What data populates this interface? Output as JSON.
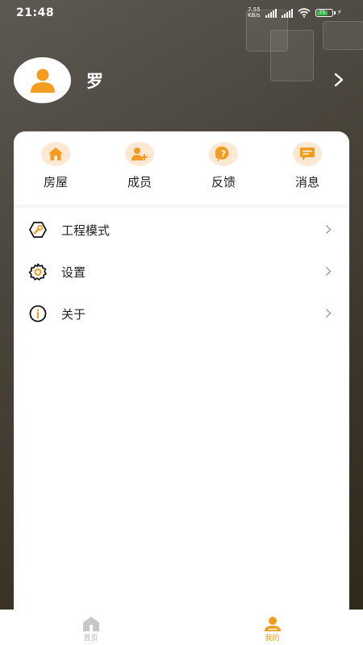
{
  "status_bar": {
    "time": "21:48",
    "net_speed_value": "7.55",
    "net_speed_unit": "KB/s",
    "battery_level": "75"
  },
  "profile": {
    "username": "罗"
  },
  "quick_actions": [
    {
      "label": "房屋",
      "icon": "house-icon"
    },
    {
      "label": "成员",
      "icon": "add-member-icon"
    },
    {
      "label": "反馈",
      "icon": "feedback-icon"
    },
    {
      "label": "消息",
      "icon": "message-icon"
    }
  ],
  "menu": [
    {
      "label": "工程模式",
      "icon": "wrench-hexagon-icon"
    },
    {
      "label": "设置",
      "icon": "gear-icon"
    },
    {
      "label": "关于",
      "icon": "info-icon"
    }
  ],
  "tabbar": {
    "tabs": [
      {
        "label": "首页",
        "icon": "home-icon",
        "active": false
      },
      {
        "label": "我的",
        "icon": "user-icon",
        "active": true
      }
    ]
  },
  "colors": {
    "accent": "#f39c1f",
    "accent_light": "#fde8d3",
    "tab_inactive": "#c7c7c7",
    "text": "#222222"
  }
}
